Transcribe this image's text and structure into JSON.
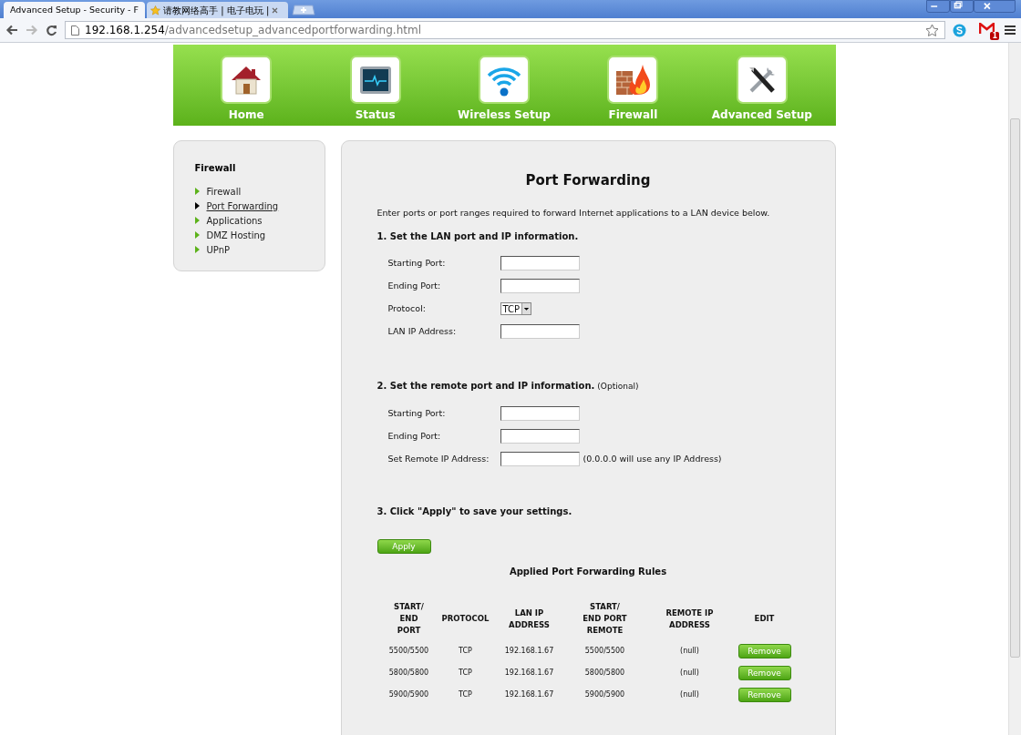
{
  "browser": {
    "tabs": [
      {
        "title": "Advanced Setup - Security - F",
        "selected": true
      },
      {
        "title": "请教网络高手 | 电子电玩 |",
        "selected": false
      }
    ],
    "url_host": "192.168.1.254",
    "url_path": "/advancedsetup_advancedportforwarding.html",
    "mail_badge": "1"
  },
  "top_nav": [
    {
      "label": "Home"
    },
    {
      "label": "Status"
    },
    {
      "label": "Wireless Setup"
    },
    {
      "label": "Firewall"
    },
    {
      "label": "Advanced Setup"
    }
  ],
  "sidebar": {
    "title": "Firewall",
    "items": [
      {
        "label": "Firewall",
        "selected": false
      },
      {
        "label": "Port Forwarding",
        "selected": true
      },
      {
        "label": "Applications",
        "selected": false
      },
      {
        "label": "DMZ Hosting",
        "selected": false
      },
      {
        "label": "UPnP",
        "selected": false
      }
    ]
  },
  "main": {
    "title": "Port Forwarding",
    "intro": "Enter ports or port ranges required to forward Internet applications to a LAN device below.",
    "section1": {
      "heading": "1. Set the LAN port and IP information.",
      "fields": [
        {
          "kind": "text",
          "label": "Starting Port:"
        },
        {
          "kind": "text",
          "label": "Ending Port:"
        },
        {
          "kind": "select",
          "label": "Protocol:",
          "value": "TCP"
        },
        {
          "kind": "text",
          "label": "LAN IP Address:"
        }
      ]
    },
    "section2": {
      "heading": "2. Set the remote port and IP information.",
      "note": "(Optional)",
      "fields": [
        {
          "kind": "text",
          "label": "Starting Port:"
        },
        {
          "kind": "text",
          "label": "Ending Port:"
        },
        {
          "kind": "text",
          "label": "Set Remote IP Address:",
          "hint": "(0.0.0.0 will use any IP Address)"
        }
      ]
    },
    "section3": {
      "heading": "3. Click \"Apply\" to save your settings."
    },
    "apply_button": "Apply",
    "table": {
      "title": "Applied Port Forwarding Rules",
      "columns": [
        "START/\nEND\nPORT",
        "PROTOCOL",
        "LAN IP\nADDRESS",
        "START/\nEND PORT\nREMOTE",
        "REMOTE IP\nADDRESS",
        "EDIT"
      ],
      "rows": [
        {
          "cells": [
            "5500/5500",
            "TCP",
            "192.168.1.67",
            "5500/5500",
            "(null)"
          ],
          "button": "Remove"
        },
        {
          "cells": [
            "5800/5800",
            "TCP",
            "192.168.1.67",
            "5800/5800",
            "(null)"
          ],
          "button": "Remove"
        },
        {
          "cells": [
            "5900/5900",
            "TCP",
            "192.168.1.67",
            "5900/5900",
            "(null)"
          ],
          "button": "Remove"
        }
      ]
    }
  }
}
